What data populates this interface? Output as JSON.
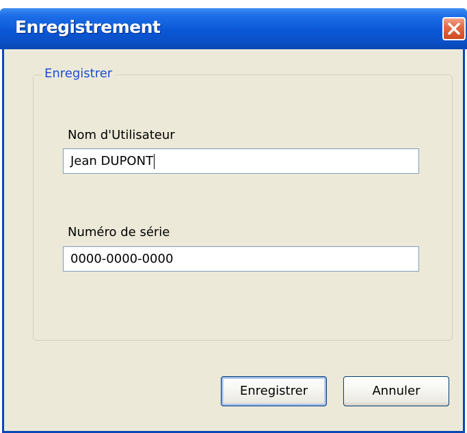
{
  "window": {
    "title": "Enregistrement",
    "close_icon": "close-icon"
  },
  "group": {
    "legend": "Enregistrer"
  },
  "fields": {
    "username": {
      "label": "Nom d'Utilisateur",
      "value": "Jean DUPONT"
    },
    "serial": {
      "label": "Numéro de série",
      "value": "0000-0000-0000"
    }
  },
  "buttons": {
    "register": "Enregistrer",
    "cancel": "Annuler"
  },
  "colors": {
    "titlebar": "#0a57d6",
    "client_background": "#ece9d8",
    "legend_text": "#1a4fd0",
    "close_button": "#e36b46"
  }
}
